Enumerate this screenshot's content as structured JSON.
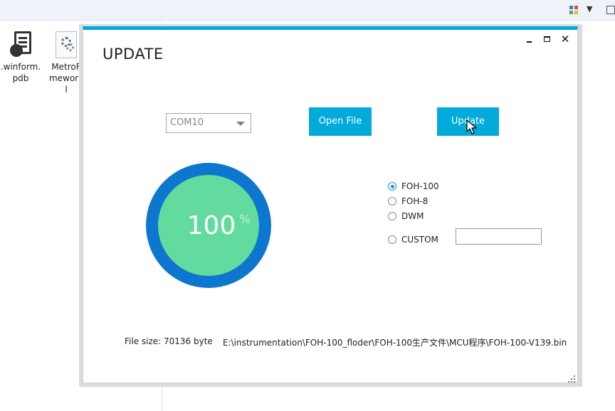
{
  "desktop": {
    "files": [
      {
        "name_line1": ".winform.",
        "name_line2": "pdb",
        "name_line3": ""
      },
      {
        "name_line1": "MetroF",
        "name_line2": "mework",
        "name_line3": "l"
      }
    ]
  },
  "dialog": {
    "title": "UPDATE",
    "accent_color": "#00aadb",
    "port_select": {
      "value": "COM10"
    },
    "open_file_label": "Open File",
    "update_label": "Update",
    "progress": {
      "value": "100",
      "unit": "%",
      "percent": 100,
      "ring_color": "#0d77d0",
      "fill_color": "#63db9e"
    },
    "device_options": [
      {
        "label": "FOH-100",
        "checked": true
      },
      {
        "label": "FOH-8",
        "checked": false
      },
      {
        "label": "DWM",
        "checked": false
      },
      {
        "label": "CUSTOM",
        "checked": false
      }
    ],
    "custom_input": {
      "value": ""
    },
    "file_size": "File size: 70136 byte",
    "file_path": "E:\\instrumentation\\FOH-100_floder\\FOH-100生产文件\\MCU程序\\FOH-100-V139.bin"
  }
}
